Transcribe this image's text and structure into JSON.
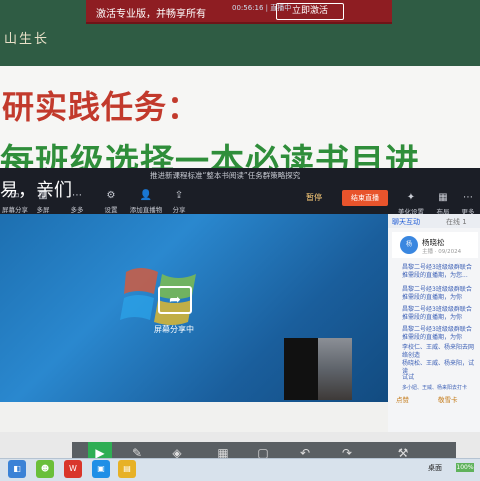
{
  "slide": {
    "logo_text": "山生长",
    "line1": "研实践任务：",
    "line2": "每班级选择一本必读书目进"
  },
  "activate_bar": {
    "live_status": "00:56:16 | 直播中",
    "text": "激活专业版，并畅享所有",
    "button": "立即激活"
  },
  "meeting": {
    "title": "推进新课程标准“整本书阅读”任务群策略探究",
    "overlay_text": "易，亲们",
    "toolbar": [
      {
        "label": "屏幕分享",
        "icon": "monitor-icon"
      },
      {
        "label": "多屏",
        "icon": "multi-screen-icon"
      },
      {
        "label": "多多",
        "icon": "more-icon"
      },
      {
        "label": "设置",
        "icon": "gear-icon"
      },
      {
        "label": "添加直播物",
        "icon": "add-person-icon"
      },
      {
        "label": "分享",
        "icon": "share-icon"
      }
    ],
    "pause_label": "暂停",
    "end_live_label": "结束直播",
    "share_screen_label": "屏幕分享中",
    "right_icons": [
      "美化设置",
      "布局",
      "更多"
    ]
  },
  "chat": {
    "tab_chat": "聊天互动",
    "tab_members": "在线 1",
    "host_name": "杨晓松",
    "host_role": "主播 · 09/2024",
    "messages": [
      "昌黎二号经3班级级群联合推需段的直播期，为您...",
      "昌黎二号经3班级级群联合推需段的直播期，为你",
      "昌黎二号经3班级级群联合推需段的直播期，为你",
      "昌黎二号经3班级级群联合推需段的直播期，为你",
      "李校仁、王威、杨来阳去网络创造",
      "杨晓松、王威、杨来阳，试读",
      "试试",
      "多小妞、王威、杨来阳去打卡"
    ],
    "like_label": "点赞",
    "gift_label": "敬雪卡"
  },
  "taskbar": {
    "tray_text": "桌面",
    "battery_text": "100%"
  }
}
